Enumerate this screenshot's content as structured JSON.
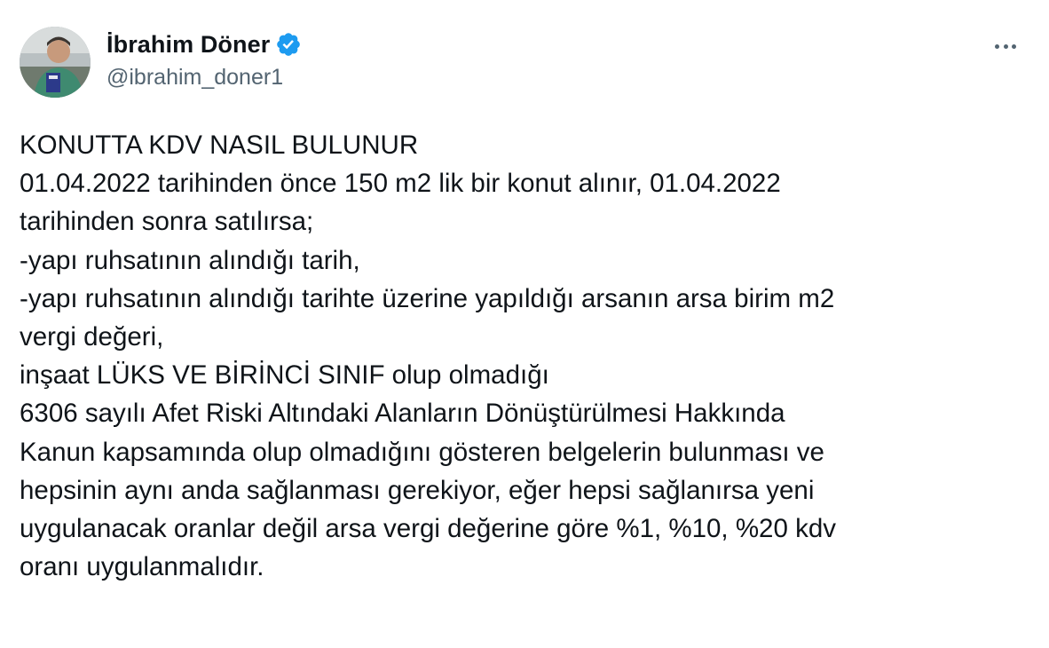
{
  "author": {
    "display_name": "İbrahim Döner",
    "handle": "@ibrahim_doner1",
    "verified": true,
    "verified_color": "#1d9bf0"
  },
  "icons": {
    "avatar": "avatar-photo",
    "verified": "verified-badge-icon",
    "more": "more-options-icon"
  },
  "tweet": {
    "lines": [
      "KONUTTA KDV NASIL BULUNUR",
      "01.04.2022 tarihinden önce 150 m2 lik bir konut alınır, 01.04.2022",
      "tarihinden sonra satılırsa;",
      "-yapı ruhsatının alındığı tarih,",
      "-yapı ruhsatının alındığı tarihte üzerine yapıldığı arsanın arsa birim m2",
      "vergi değeri,",
      "inşaat LÜKS VE BİRİNCİ SINIF olup olmadığı",
      "6306 sayılı Afet Riski Altındaki Alanların Dönüştürülmesi Hakkında",
      "Kanun kapsamında olup olmadığını gösteren belgelerin bulunması ve",
      "hepsinin aynı anda sağlanması gerekiyor, eğer hepsi sağlanırsa yeni",
      "uygulanacak oranlar değil arsa vergi değerine göre %1, %10, %20 kdv",
      "oranı uygulanmalıdır."
    ]
  }
}
